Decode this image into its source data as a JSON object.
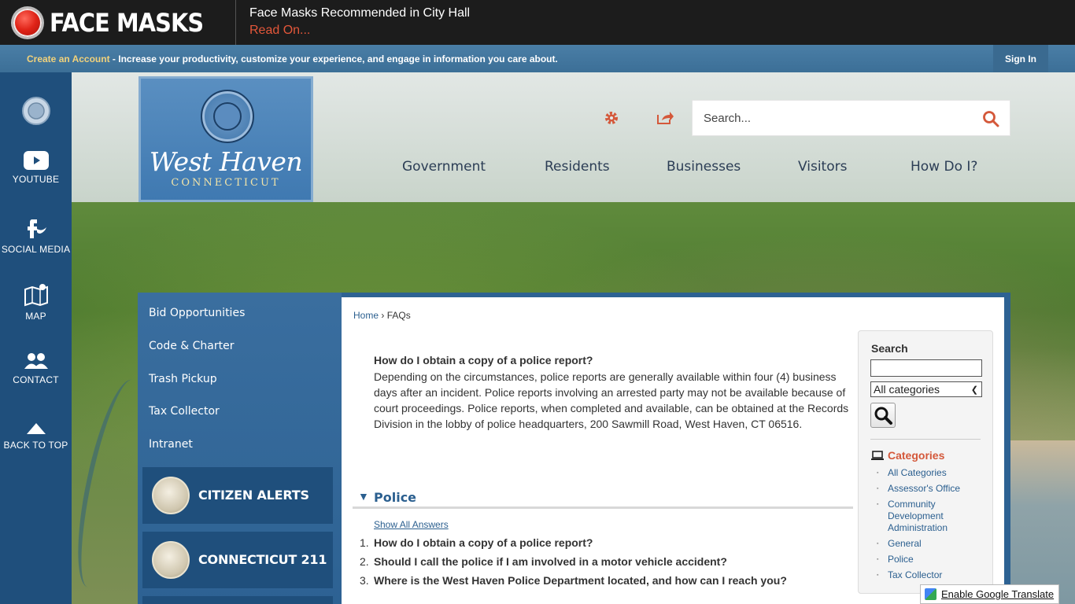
{
  "alert": {
    "title": "FACE MASKS",
    "headline": "Face Masks Recommended in City Hall",
    "link": "Read On..."
  },
  "account_bar": {
    "create_link": "Create an Account",
    "text": " - Increase your productivity, customize your experience, and engage in information you care about.",
    "sign_in": "Sign In"
  },
  "rail": {
    "items": [
      {
        "label": "",
        "icon": "city-seal-icon"
      },
      {
        "label": "YOUTUBE",
        "icon": "youtube-icon"
      },
      {
        "label": "SOCIAL MEDIA",
        "icon": "social-media-icon"
      },
      {
        "label": "MAP",
        "icon": "map-icon"
      },
      {
        "label": "CONTACT",
        "icon": "contact-icon"
      },
      {
        "label": "BACK TO TOP",
        "icon": "arrow-up-icon"
      }
    ]
  },
  "logo": {
    "name": "West Haven",
    "state": "CONNECTICUT"
  },
  "header": {
    "search_placeholder": "Search...",
    "nav": [
      "Government",
      "Residents",
      "Businesses",
      "Visitors",
      "How Do I?"
    ]
  },
  "menu": {
    "links": [
      "Bid Opportunities",
      "Code & Charter",
      "Trash Pickup",
      "Tax Collector",
      "Intranet"
    ],
    "promos": [
      "CITIZEN ALERTS",
      "CONNECTICUT 211"
    ]
  },
  "content": {
    "breadcrumb_home": "Home",
    "breadcrumb_sep": "›",
    "breadcrumb_current": "FAQs",
    "question": "How do I obtain a copy of a police report?",
    "answer": "Depending on the circumstances, police reports are generally available within four (4) business days after an incident. Police reports involving an arrested party may not be available because of court proceedings. Police reports, when completed and available, can be obtained at the Records Division in the lobby of police headquarters, 200 Sawmill Road, West Haven, CT 06516.",
    "category_title": "Police",
    "show_all": "Show All Answers",
    "questions": [
      "How do I obtain a copy of a police report?",
      "Should I call the police if I am involved in a motor vehicle accident?",
      "Where is the West Haven Police Department located, and how can I reach you?"
    ]
  },
  "sidebar": {
    "search_title": "Search",
    "select_value": "All categories",
    "categories_title": "Categories",
    "categories": [
      "All Categories",
      "Assessor's Office",
      "Community Development Administration",
      "General",
      "Police",
      "Tax Collector"
    ]
  },
  "translate": {
    "label": "Enable Google Translate"
  },
  "colors": {
    "alert_bg": "#1c1c1c",
    "alert_link": "#e4573a",
    "rail_bg": "#1f4f7c",
    "accent_orange": "#d4583a",
    "link_blue": "#2b5f8f"
  }
}
